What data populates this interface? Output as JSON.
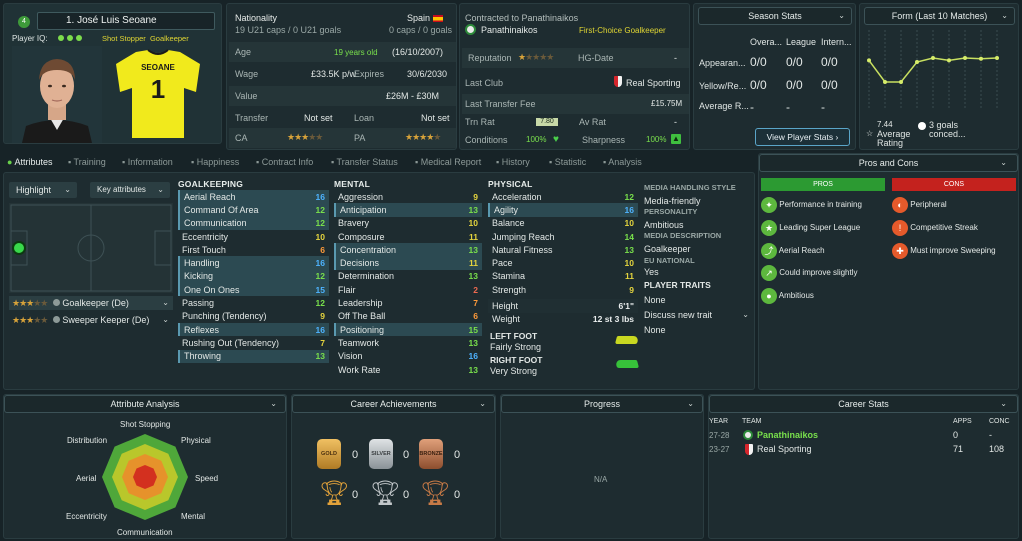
{
  "player": {
    "number": "4",
    "name": "1. José Luis Seoane",
    "iq_label": "Player IQ:",
    "roles": "Shot Stopper  Goalkeeper",
    "shirt_name": "SEOANE",
    "shirt_number": "1"
  },
  "info": {
    "nationality_label": "Nationality",
    "nationality": "Spain",
    "caps_left": "19 U21 caps / 0 U21 goals",
    "caps_right": "0 caps / 0 goals",
    "age_label": "Age",
    "age": "19 years old",
    "dob": "(16/10/2007)",
    "wage_label": "Wage",
    "wage": "£33.5K p/w",
    "expires_label": "Expires",
    "expires": "30/6/2030",
    "value_label": "Value",
    "value": "£26M - £30M",
    "transfer_label": "Transfer",
    "transfer": "Not set",
    "loan_label": "Loan",
    "loan": "Not set",
    "ca_label": "CA",
    "pa_label": "PA"
  },
  "contract": {
    "contracted": "Contracted to Panathinaikos",
    "club": "Panathinaikos",
    "status": "First-Choice Goalkeeper",
    "reputation_label": "Reputation",
    "hg_label": "HG-Date",
    "hg_value": "-",
    "last_club_label": "Last Club",
    "last_club": "Real Sporting",
    "fee_label": "Last Transfer Fee",
    "fee": "£15.75M",
    "trn_label": "Trn Rat",
    "trn": "7.80",
    "av_label": "Av Rat",
    "av": "-",
    "conditions_label": "Conditions",
    "conditions": "100%",
    "sharpness_label": "Sharpness",
    "sharpness": "100%"
  },
  "season": {
    "title": "Season Stats",
    "cols": [
      "Overa...",
      "League",
      "Intern..."
    ],
    "rows": [
      {
        "label": "Appearan...",
        "vals": [
          "0/0",
          "0/0",
          "0/0"
        ]
      },
      {
        "label": "Yellow/Re...",
        "vals": [
          "0/0",
          "0/0",
          "0/0"
        ]
      },
      {
        "label": "Average R...",
        "vals": [
          "-",
          "-",
          "-"
        ]
      }
    ],
    "button": "View Player Stats"
  },
  "form": {
    "title": "Form (Last 10 Matches)",
    "rating": "7.44",
    "rating_label1": "Average",
    "rating_label2": "Rating",
    "goals": "3 goals",
    "goals_label": "conced...",
    "points": [
      0.62,
      0.35,
      0.35,
      0.6,
      0.65,
      0.62,
      0.65,
      0.64,
      0.65
    ]
  },
  "tabs": [
    "Attributes",
    "Training",
    "Information",
    "Happiness",
    "Contract Info",
    "Transfer Status",
    "Medical Report",
    "History",
    "Statistic",
    "Analysis"
  ],
  "pitch": {
    "highlight": "Highlight",
    "key_attr": "Key attributes",
    "roles": [
      {
        "name": "Goalkeeper (De)"
      },
      {
        "name": "Sweeper Keeper (De)"
      }
    ]
  },
  "goalkeeping": {
    "title": "GOALKEEPING",
    "rows": [
      {
        "n": "Aerial Reach",
        "v": "16"
      },
      {
        "n": "Command Of Area",
        "v": "12"
      },
      {
        "n": "Communication",
        "v": "12"
      },
      {
        "n": "Eccentricity",
        "v": "10"
      },
      {
        "n": "First Touch",
        "v": "6"
      },
      {
        "n": "Handling",
        "v": "16"
      },
      {
        "n": "Kicking",
        "v": "12"
      },
      {
        "n": "One On Ones",
        "v": "15"
      },
      {
        "n": "Passing",
        "v": "12"
      },
      {
        "n": "Punching (Tendency)",
        "v": "9"
      },
      {
        "n": "Reflexes",
        "v": "16"
      },
      {
        "n": "Rushing Out (Tendency)",
        "v": "7"
      },
      {
        "n": "Throwing",
        "v": "13"
      }
    ]
  },
  "mental": {
    "title": "MENTAL",
    "rows": [
      {
        "n": "Aggression",
        "v": "9"
      },
      {
        "n": "Anticipation",
        "v": "13"
      },
      {
        "n": "Bravery",
        "v": "10"
      },
      {
        "n": "Composure",
        "v": "11"
      },
      {
        "n": "Concentration",
        "v": "13"
      },
      {
        "n": "Decisions",
        "v": "11"
      },
      {
        "n": "Determination",
        "v": "13"
      },
      {
        "n": "Flair",
        "v": "2"
      },
      {
        "n": "Leadership",
        "v": "7"
      },
      {
        "n": "Off The Ball",
        "v": "6"
      },
      {
        "n": "Positioning",
        "v": "15"
      },
      {
        "n": "Teamwork",
        "v": "13"
      },
      {
        "n": "Vision",
        "v": "16"
      },
      {
        "n": "Work Rate",
        "v": "13"
      }
    ]
  },
  "physical": {
    "title": "PHYSICAL",
    "rows": [
      {
        "n": "Acceleration",
        "v": "12"
      },
      {
        "n": "Agility",
        "v": "16"
      },
      {
        "n": "Balance",
        "v": "10"
      },
      {
        "n": "Jumping Reach",
        "v": "14"
      },
      {
        "n": "Natural Fitness",
        "v": "13"
      },
      {
        "n": "Pace",
        "v": "10"
      },
      {
        "n": "Stamina",
        "v": "11"
      },
      {
        "n": "Strength",
        "v": "9"
      }
    ],
    "height_label": "Height",
    "height": "6'1\"",
    "weight_label": "Weight",
    "weight": "12 st 3 lbs",
    "left_foot_label": "LEFT FOOT",
    "left_foot": "Fairly Strong",
    "right_foot_label": "RIGHT FOOT",
    "right_foot": "Very Strong"
  },
  "media": {
    "style_label": "MEDIA HANDLING STYLE",
    "style": "Media-friendly",
    "personality_label": "PERSONALITY",
    "personality": "Ambitious",
    "desc_label": "MEDIA DESCRIPTION",
    "desc": "Goalkeeper",
    "eu_label": "EU NATIONAL",
    "eu": "Yes",
    "traits_label": "PLAYER TRAITS",
    "traits": "None",
    "discuss": "Discuss new trait",
    "discuss_value": "None"
  },
  "proscons": {
    "title": "Pros and Cons",
    "pros_label": "PROS",
    "cons_label": "CONS",
    "pros": [
      "Performance in training",
      "Leading Super League",
      "Aerial Reach",
      "Could improve slightly",
      "Ambitious"
    ],
    "cons": [
      "Peripheral",
      "Competitive Streak",
      "Must improve Sweeping"
    ]
  },
  "analysis": {
    "title": "Attribute Analysis",
    "labels": [
      "Shot Stopping",
      "Physical",
      "Speed",
      "Mental",
      "Communication",
      "Eccentricity",
      "Aerial",
      "Distribution"
    ]
  },
  "achievements": {
    "title": "Career Achievements",
    "medals": [
      {
        "label": "GOLD",
        "count": "0"
      },
      {
        "label": "SILVER",
        "count": "0"
      },
      {
        "label": "BRONZE",
        "count": "0"
      }
    ],
    "trophies": [
      "0",
      "0",
      "0"
    ]
  },
  "progress": {
    "title": "Progress",
    "empty": "N/A"
  },
  "career": {
    "title": "Career Stats",
    "cols": [
      "YEAR",
      "TEAM",
      "APPS",
      "CONC"
    ],
    "rows": [
      {
        "year": "27-28",
        "team": "Panathinaikos",
        "apps": "0",
        "conc": "-"
      },
      {
        "year": "23-27",
        "team": "Real Sporting",
        "apps": "71",
        "conc": "108"
      }
    ]
  }
}
